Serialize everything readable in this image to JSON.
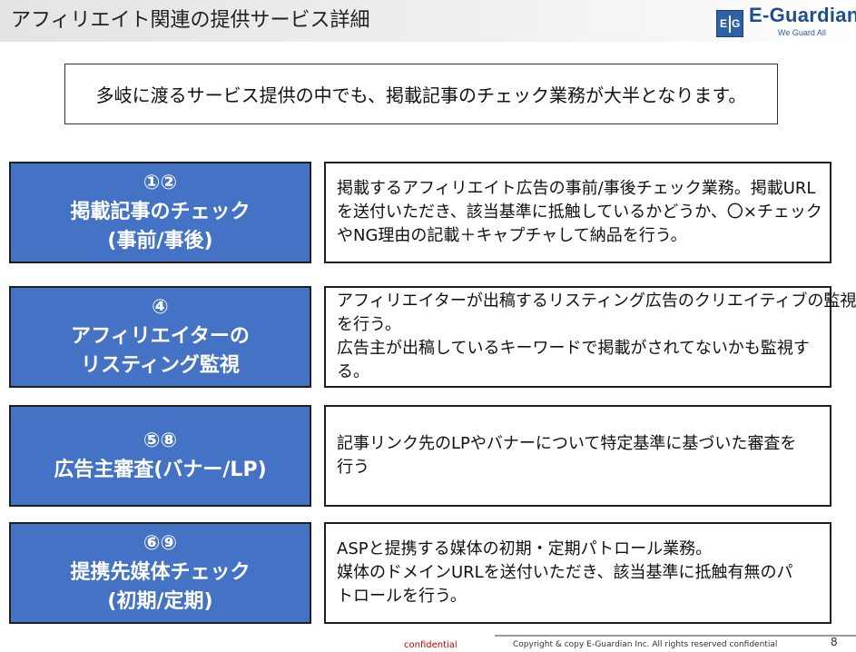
{
  "header": {
    "title": "アフィリエイト関連の提供サービス詳細",
    "logo": {
      "mark_left": "E",
      "mark_right": "G",
      "name": "E-Guardian",
      "tagline": "We Guard All",
      "brand_color": "#1f4e8f"
    }
  },
  "summary": "多岐に渡るサービス提供の中でも、掲載記事のチェック業務が大半となります。",
  "services": [
    {
      "label_lines": [
        "①②",
        "掲載記事のチェック",
        "(事前/事後)"
      ],
      "desc_lines": [
        "掲載するアフィリエイト広告の事前/事後チェック業務。掲載URL",
        "を送付いただき、該当基準に抵触しているかどうか、〇×チェック",
        "やNG理由の記載＋キャプチャして納品を行う。"
      ]
    },
    {
      "label_lines": [
        "④",
        "アフィリエイターの",
        "リスティング監視"
      ],
      "desc_lines": [
        "アフィリエイターが出稿するリスティング広告のクリエイティブの監視",
        "を行う。",
        "広告主が出稿しているキーワードで掲載がされてないかも監視す",
        "る。"
      ]
    },
    {
      "label_lines": [
        "⑤⑧",
        "広告主審査(バナー/LP)"
      ],
      "desc_lines": [
        "記事リンク先のLPやバナーについて特定基準に基づいた審査を",
        "行う"
      ]
    },
    {
      "label_lines": [
        "⑥⑨",
        "提携先媒体チェック",
        "(初期/定期)"
      ],
      "desc_lines": [
        "ASPと提携する媒体の初期・定期パトロール業務。",
        "媒体のドメインURLを送付いただき、該当基準に抵触有無のパ",
        "トロールを行う。"
      ]
    }
  ],
  "footer": {
    "confidential": "confidential",
    "copyright": "Copyright & copy E-Guardian Inc.  All rights reserved  confidential",
    "page_number": "8"
  },
  "colors": {
    "label_fill": "#4472c4",
    "footer_confidential": "#c00000"
  }
}
